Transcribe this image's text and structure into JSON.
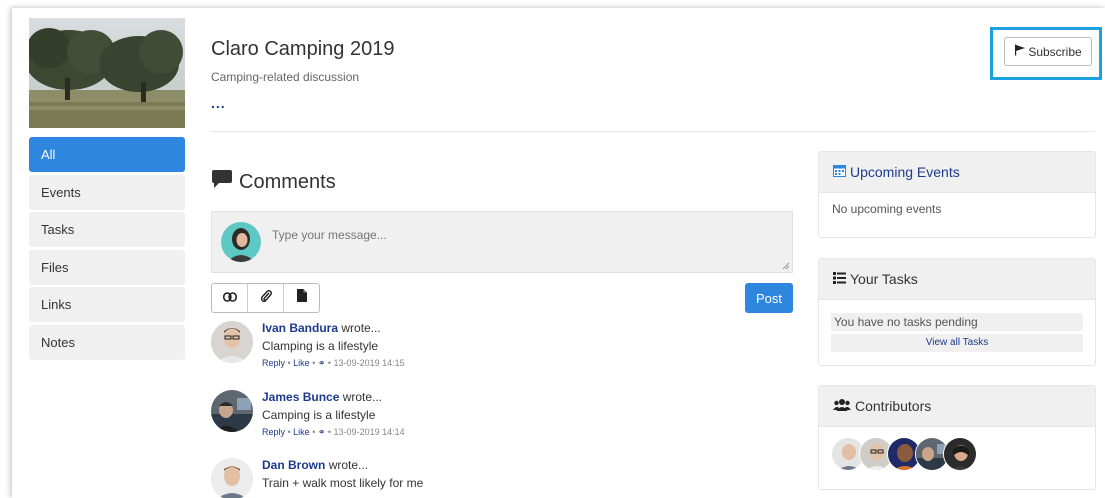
{
  "group": {
    "title": "Claro Camping 2019",
    "subtitle": "Camping-related discussion",
    "more": "..."
  },
  "subscribe": {
    "label": "Subscribe"
  },
  "nav": {
    "items": [
      {
        "label": "All",
        "active": true
      },
      {
        "label": "Events"
      },
      {
        "label": "Tasks"
      },
      {
        "label": "Files"
      },
      {
        "label": "Links"
      },
      {
        "label": "Notes"
      }
    ]
  },
  "comments": {
    "heading": "Comments",
    "placeholder": "Type your message...",
    "post_label": "Post",
    "items": [
      {
        "author": "Ivan Bandura",
        "wrote": "wrote...",
        "text": "Clamping is a lifestyle",
        "reply": "Reply",
        "like": "Like",
        "timestamp": "13-09-2019 14:15"
      },
      {
        "author": "James Bunce",
        "wrote": "wrote...",
        "text": "Camping is a lifestyle",
        "reply": "Reply",
        "like": "Like",
        "timestamp": "13-09-2019 14:14"
      },
      {
        "author": "Dan Brown",
        "wrote": "wrote...",
        "text": "Train + walk most likely for me"
      }
    ]
  },
  "sidebar": {
    "events": {
      "title": "Upcoming Events",
      "empty": "No upcoming events"
    },
    "tasks": {
      "title": "Your Tasks",
      "empty": "You have no tasks pending",
      "view_all": "View all Tasks"
    },
    "contributors": {
      "title": "Contributors"
    }
  },
  "colors": {
    "accent": "#2e86de",
    "link": "#1d3b8c",
    "highlight": "#1ba0e1"
  }
}
